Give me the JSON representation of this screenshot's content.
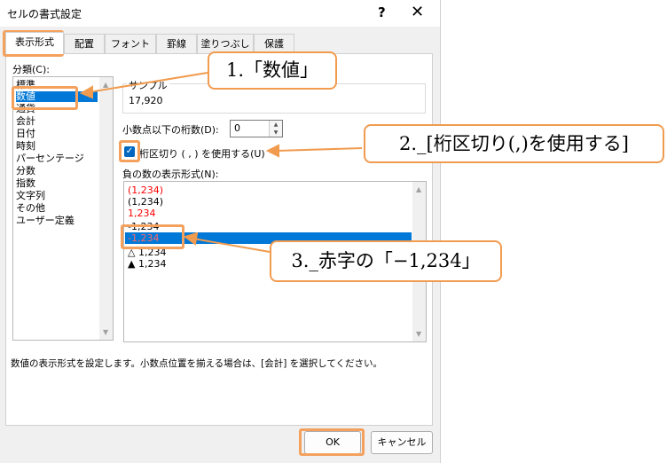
{
  "dialog": {
    "title": "セルの書式設定",
    "help_icon": "?",
    "close_icon": "✕",
    "tabs": [
      "表示形式",
      "配置",
      "フォント",
      "罫線",
      "塗りつぶし",
      "保護"
    ],
    "category_label": "分類(C):",
    "categories": [
      "標準",
      "数値",
      "通貨",
      "会計",
      "日付",
      "時刻",
      "パーセンテージ",
      "分数",
      "指数",
      "文字列",
      "その他",
      "ユーザー定義"
    ],
    "selected_category": "数値",
    "sample_label": "サンプル",
    "sample_value": "17,920",
    "decimal_label": "小数点以下の桁数(D):",
    "decimal_value": "0",
    "separator_label": "桁区切り ( , ) を使用する(U)",
    "separator_checked": true,
    "negative_label": "負の数の表示形式(N):",
    "negative_formats": [
      {
        "text": "(1,234)",
        "color": "#ff0000"
      },
      {
        "text": "(1,234)",
        "color": "#000000"
      },
      {
        "text": "1,234",
        "color": "#ff0000"
      },
      {
        "text": "-1,234",
        "color": "#000000"
      },
      {
        "text": "-1,234",
        "color": "#ff0000"
      },
      {
        "text": "△ 1,234",
        "color": "#000000"
      },
      {
        "text": "▲ 1,234",
        "color": "#000000"
      }
    ],
    "selected_negative_index": 4,
    "description": "数値の表示形式を設定します。小数点位置を揃える場合は、[会計] を選択してください。",
    "ok_label": "OK",
    "cancel_label": "キャンセル"
  },
  "callouts": {
    "step1": "1.「数値」",
    "step2": "2._[桁区切り(,)を使用する]",
    "step3": "3._赤字の「−1,234」"
  },
  "colors": {
    "accent": "#0078d7",
    "callout": "#f19b4f",
    "negative_red": "#ff0000"
  }
}
